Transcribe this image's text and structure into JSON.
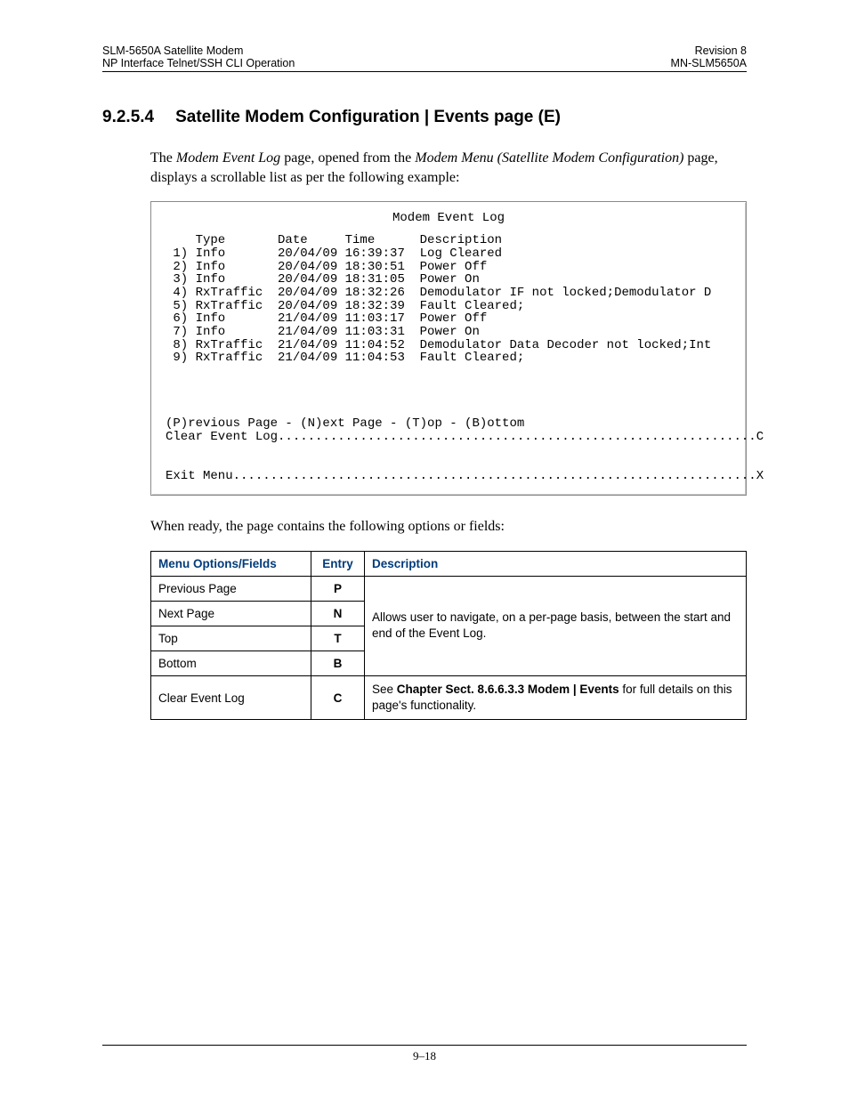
{
  "header": {
    "left_line1": "SLM-5650A Satellite Modem",
    "left_line2": "NP Interface Telnet/SSH CLI Operation",
    "right_line1": "Revision 8",
    "right_line2": "MN-SLM5650A"
  },
  "section": {
    "number": "9.2.5.4",
    "title": "Satellite Modem Configuration | Events page (E)"
  },
  "intro": {
    "pre": "The ",
    "ital1": "Modem Event Log",
    "mid1": " page,  opened from the ",
    "ital2": "Modem Menu (Satellite Modem Configuration)",
    "mid2": " page, displays a scrollable list as per the following example:"
  },
  "terminal": {
    "title": "Modem Event Log",
    "header_row": "    Type       Date     Time      Description",
    "rows": [
      " 1) Info       20/04/09 16:39:37  Log Cleared",
      " 2) Info       20/04/09 18:30:51  Power Off",
      " 3) Info       20/04/09 18:31:05  Power On",
      " 4) RxTraffic  20/04/09 18:32:26  Demodulator IF not locked;Demodulator D",
      " 5) RxTraffic  20/04/09 18:32:39  Fault Cleared;",
      " 6) Info       21/04/09 11:03:17  Power Off",
      " 7) Info       21/04/09 11:03:31  Power On",
      " 8) RxTraffic  21/04/09 11:04:52  Demodulator Data Decoder not locked;Int",
      " 9) RxTraffic  21/04/09 11:04:53  Fault Cleared;"
    ],
    "nav_line": "(P)revious Page - (N)ext Page - (T)op - (B)ottom",
    "clear_line": "Clear Event Log................................................................C",
    "exit_line": "Exit Menu......................................................................X"
  },
  "after_terminal": "When ready, the page contains the following options or fields:",
  "table": {
    "headers": {
      "name": "Menu Options/Fields",
      "entry": "Entry",
      "desc": "Description"
    },
    "nav_desc": "Allows user to navigate, on a per-page basis, between the start and end of the Event Log.",
    "rows": [
      {
        "name": "Previous Page",
        "entry": "P"
      },
      {
        "name": "Next Page",
        "entry": "N"
      },
      {
        "name": "Top",
        "entry": "T"
      },
      {
        "name": "Bottom",
        "entry": "B"
      }
    ],
    "clear_row": {
      "name": "Clear Event Log",
      "entry": "C",
      "desc_pre": "See ",
      "desc_bold": "Chapter Sect. 8.6.6.3.3 Modem | Events",
      "desc_post": " for full details on this page's functionality."
    }
  },
  "footer": "9–18"
}
